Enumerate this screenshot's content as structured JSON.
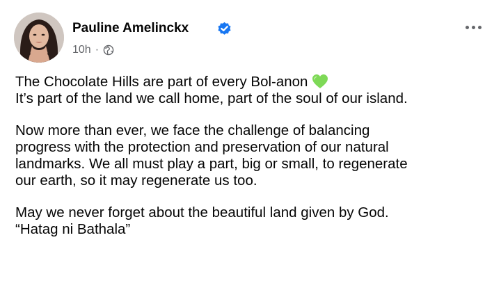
{
  "post": {
    "author": {
      "name": "Pauline Amelinckx",
      "avatar_icon": "profile-photo",
      "verified_icon": "verified-badge-icon"
    },
    "meta": {
      "timestamp": "10h",
      "separator": "·",
      "audience_icon": "globe-icon"
    },
    "menu_icon": "more-options-icon",
    "body": {
      "line1": "The Chocolate Hills are part of every Bol-anon",
      "line1_emoji": "green-heart-icon",
      "line2": "It’s part of the land we call home, part of the soul of our island.",
      "para2": [
        "Now more than ever, we face the challenge of balancing",
        "progress with the protection and preservation of our natural",
        "landmarks. We all must play a part, big or small, to regenerate",
        "our earth, so it may regenerate us too."
      ],
      "para3": [
        "May we never forget about the beautiful land given by God.",
        "“Hatag ni Bathala”"
      ]
    }
  },
  "colors": {
    "text_primary": "#050505",
    "text_secondary": "#65676b",
    "verified_blue": "#1877f2",
    "heart_green": "#7ed957",
    "background": "#ffffff"
  }
}
